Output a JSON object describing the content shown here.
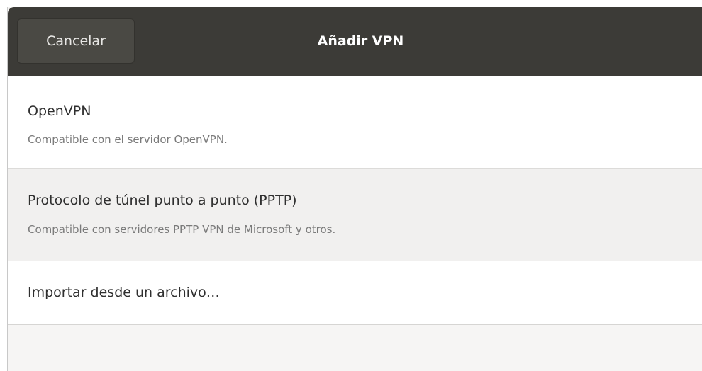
{
  "header": {
    "cancel_label": "Cancelar",
    "title": "Añadir VPN"
  },
  "options": [
    {
      "title": "OpenVPN",
      "subtitle": "Compatible con el servidor OpenVPN."
    },
    {
      "title": "Protocolo de túnel punto a punto (PPTP)",
      "subtitle": "Compatible con servidores PPTP VPN de Microsoft y otros."
    },
    {
      "title": "Importar desde un archivo…"
    }
  ],
  "colors": {
    "titlebar": "#3c3b37",
    "hover_row": "#f1f0ef",
    "text": "#2f2f2f",
    "subtext": "#7a7a7a"
  }
}
